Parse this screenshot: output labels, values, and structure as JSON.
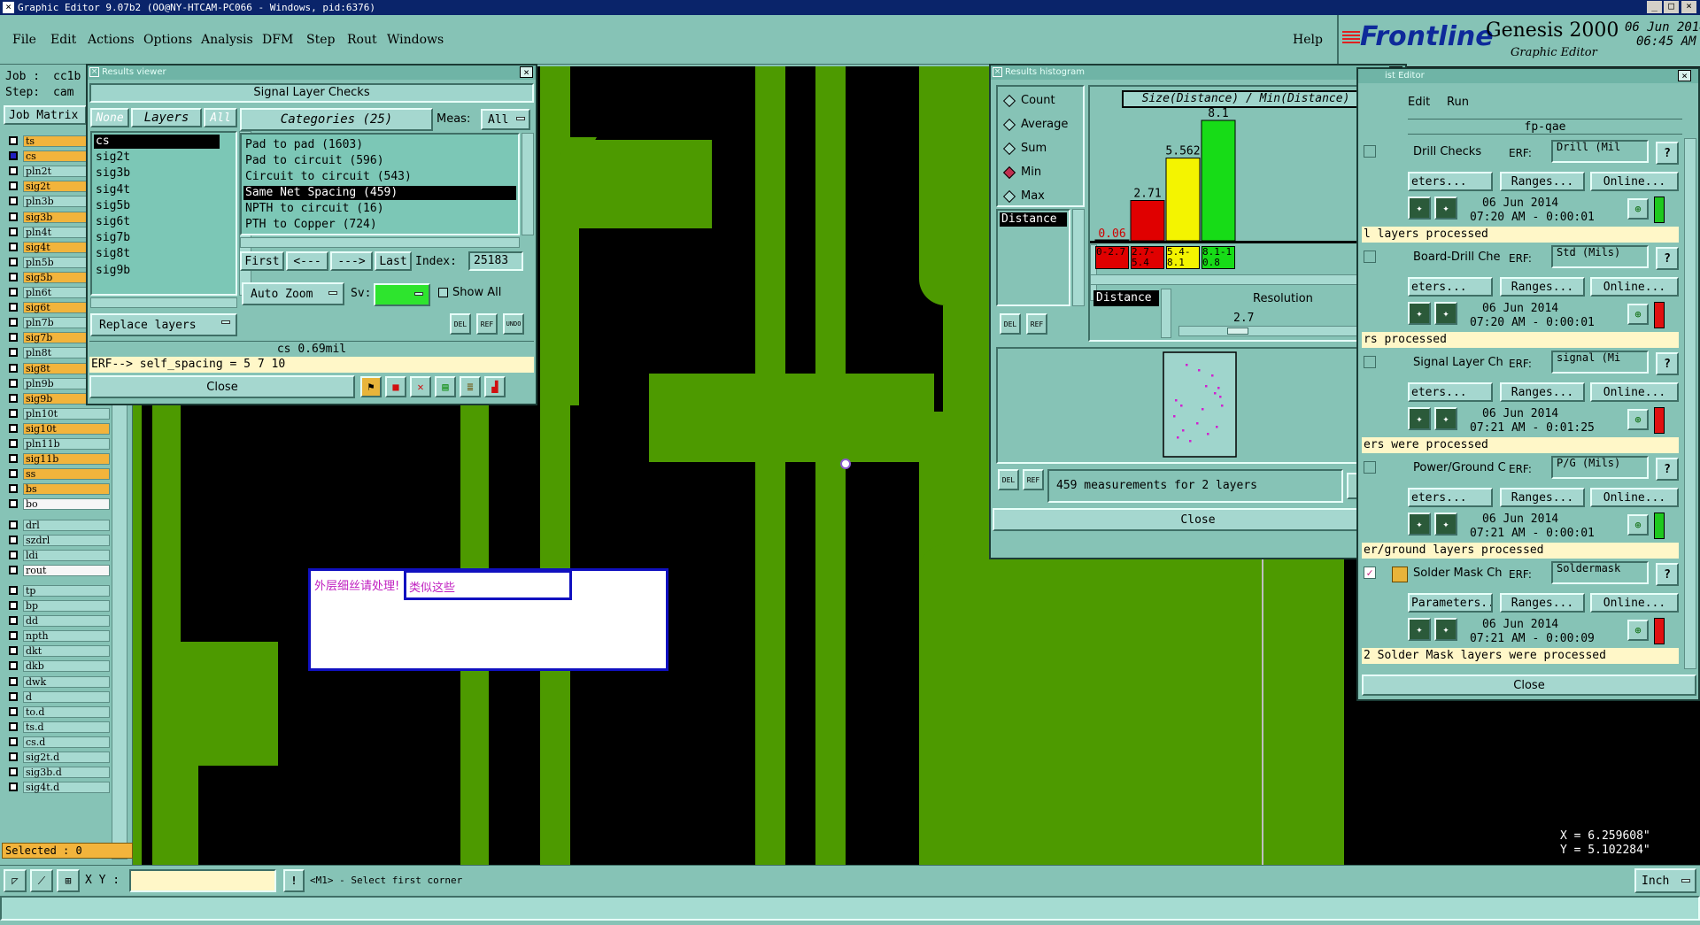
{
  "title_bar": {
    "text": "Graphic Editor 9.07b2 (OO@NY-HTCAM-PC066 - Windows, pid:6376)",
    "icon": "x-icon",
    "btn_min": "_",
    "btn_max": "□",
    "btn_close": "×"
  },
  "menu": {
    "items": [
      "File",
      "Edit",
      "Actions",
      "Options",
      "Analysis",
      "DFM",
      "Step",
      "Rout",
      "Windows"
    ],
    "help": "Help"
  },
  "brand": {
    "logo": "Frontline",
    "product": "Genesis 2000",
    "sub": "Graphic Editor",
    "date": "06 Jun 2014",
    "time": "06:45 AM"
  },
  "job": {
    "job_label": "Job :",
    "job_value": "cc1b",
    "step_label": "Step:",
    "step_value": "cam",
    "matrix_btn": "Job Matrix"
  },
  "layers": [
    {
      "name": "ts",
      "state": "on",
      "arrow": ""
    },
    {
      "name": "cs",
      "state": "on",
      "arrow": "",
      "sel": true
    },
    {
      "name": "pln2t",
      "state": "off",
      "arrow": ""
    },
    {
      "name": "sig2t",
      "state": "on",
      "arrow": ""
    },
    {
      "name": "pln3b",
      "state": "off",
      "arrow": ""
    },
    {
      "name": "sig3b",
      "state": "on",
      "arrow": ""
    },
    {
      "name": "pln4t",
      "state": "off",
      "arrow": ""
    },
    {
      "name": "sig4t",
      "state": "on",
      "arrow": ""
    },
    {
      "name": "pln5b",
      "state": "off",
      "arrow": ""
    },
    {
      "name": "sig5b",
      "state": "on",
      "arrow": ""
    },
    {
      "name": "pln6t",
      "state": "off",
      "arrow": ""
    },
    {
      "name": "sig6t",
      "state": "on",
      "arrow": ""
    },
    {
      "name": "pln7b",
      "state": "off",
      "arrow": ""
    },
    {
      "name": "sig7b",
      "state": "on",
      "arrow": ""
    },
    {
      "name": "pln8t",
      "state": "off",
      "arrow": ""
    },
    {
      "name": "sig8t",
      "state": "on",
      "arrow": "◢"
    },
    {
      "name": "pln9b",
      "state": "off",
      "arrow": ""
    },
    {
      "name": "sig9b",
      "state": "on",
      "arrow": "◢"
    },
    {
      "name": "pln10t",
      "state": "off",
      "arrow": ""
    },
    {
      "name": "sig10t",
      "state": "on",
      "arrow": "◢"
    },
    {
      "name": "pln11b",
      "state": "off",
      "arrow": ""
    },
    {
      "name": "sig11b",
      "state": "on",
      "arrow": "◢"
    },
    {
      "name": "ss",
      "state": "on",
      "arrow": "◢"
    },
    {
      "name": "bs",
      "state": "on",
      "arrow": ""
    },
    {
      "name": "bo",
      "state": "wh",
      "arrow": "◢"
    },
    {
      "name": "drl",
      "state": "off",
      "arrow": ""
    },
    {
      "name": "szdrl",
      "state": "off",
      "arrow": ""
    },
    {
      "name": "ldi",
      "state": "off",
      "arrow": ""
    },
    {
      "name": "rout",
      "state": "wh",
      "arrow": ""
    },
    {
      "name": "tp",
      "state": "off",
      "arrow": ""
    },
    {
      "name": "bp",
      "state": "off",
      "arrow": ""
    },
    {
      "name": "dd",
      "state": "off",
      "arrow": ""
    },
    {
      "name": "npth",
      "state": "off",
      "arrow": ""
    },
    {
      "name": "dkt",
      "state": "off",
      "arrow": ""
    },
    {
      "name": "dkb",
      "state": "off",
      "arrow": ""
    },
    {
      "name": "dwk",
      "state": "off",
      "arrow": ""
    },
    {
      "name": "d",
      "state": "off",
      "arrow": ""
    },
    {
      "name": "to.d",
      "state": "off",
      "arrow": "◢"
    },
    {
      "name": "ts.d",
      "state": "off",
      "arrow": ""
    },
    {
      "name": "cs.d",
      "state": "off",
      "arrow": "◢"
    },
    {
      "name": "sig2t.d",
      "state": "off",
      "arrow": "◢"
    },
    {
      "name": "sig3b.d",
      "state": "off",
      "arrow": ""
    },
    {
      "name": "sig4t.d",
      "state": "off",
      "arrow": "◢"
    }
  ],
  "selected": "Selected : 0",
  "results_viewer": {
    "title": "Results viewer",
    "header": "Signal Layer Checks",
    "none": "None",
    "layers": "Layers",
    "all": "All",
    "layer_list": [
      "cs",
      "sig2t",
      "sig3b",
      "sig4t",
      "sig5b",
      "sig6t",
      "sig7b",
      "sig8t",
      "sig9b"
    ],
    "categories_label": "Categories (25)",
    "meas_label": "Meas:",
    "meas_value": "All",
    "categories": [
      "Pad to pad (1603)",
      "Pad to circuit (596)",
      "Circuit to circuit (543)",
      "Same Net Spacing (459)",
      "NPTH to circuit (16)",
      "PTH to Copper (724)"
    ],
    "first": "First",
    "prev": "<---",
    "next": "--->",
    "last": "Last",
    "index_label": "Index:",
    "index_value": "25183",
    "auto_zoom": "Auto Zoom",
    "sv_label": "Sv:",
    "show_all": "Show All",
    "replace_layers": "Replace layers",
    "del": "DEL",
    "ref": "REF",
    "undo": "UNDO",
    "status": "cs 0.69mil",
    "erf": "ERF--> self_spacing = 5 7 10",
    "close": "Close"
  },
  "histogram": {
    "title": "Results histogram",
    "heading": "Size(Distance) / Min(Distance)",
    "options": [
      "Count",
      "Average",
      "Sum",
      "Min",
      "Max"
    ],
    "selected_option": "Min",
    "distance": "Distance",
    "resolution_label": "Resolution",
    "resolution_value": "2.7",
    "summary": "459 measurements for 2 layers",
    "close": "Close",
    "del": "DEL",
    "ref": "REF"
  },
  "chart_data": {
    "type": "bar",
    "title": "Size(Distance) / Min(Distance)",
    "categories": [
      "0-2.7",
      "2.7-5.4",
      "5.4-8.1",
      "8.1-10.8"
    ],
    "values": [
      0.06,
      2.71,
      5.562,
      8.1
    ],
    "value_labels": [
      "0.06",
      "2.71",
      "5.562",
      "8.1"
    ],
    "colors": [
      "#e00000",
      "#e00000",
      "#f4f400",
      "#17dc17"
    ],
    "ylim": [
      0,
      8.1
    ]
  },
  "checklist": {
    "title": "ist Editor",
    "menu_edit": "Edit",
    "menu_run": "Run",
    "header": "fp-qae",
    "items": [
      {
        "name": "Drill Checks",
        "erf": "ERF:",
        "erf_value": "Drill (Mil",
        "params": "eters...",
        "ranges": "Ranges...",
        "online": "Online...",
        "date": "06 Jun 2014",
        "time": "07:20 AM - 0:00:01",
        "result": "l layers processed",
        "status": "#1ec81e"
      },
      {
        "name": "Board-Drill Che",
        "erf": "ERF:",
        "erf_value": "Std (Mils)",
        "params": "eters...",
        "ranges": "Ranges...",
        "online": "Online...",
        "date": "06 Jun 2014",
        "time": "07:20 AM - 0:00:01",
        "result": "rs processed",
        "status": "#e01010"
      },
      {
        "name": "Signal Layer Ch",
        "erf": "ERF:",
        "erf_value": "signal (Mi",
        "params": "eters...",
        "ranges": "Ranges...",
        "online": "Online...",
        "date": "06 Jun 2014",
        "time": "07:21 AM - 0:01:25",
        "result": "ers were processed",
        "status": "#e01010"
      },
      {
        "name": "Power/Ground C",
        "erf": "ERF:",
        "erf_value": "P/G (Mils)",
        "params": "eters...",
        "ranges": "Ranges...",
        "online": "Online...",
        "date": "06 Jun 2014",
        "time": "07:21 AM - 0:00:01",
        "result": "er/ground layers processed",
        "status": "#1ec81e"
      },
      {
        "name": "Solder Mask Ch",
        "erf": "ERF:",
        "erf_value": "Soldermask",
        "params": "Parameters...",
        "ranges": "Ranges...",
        "online": "Online...",
        "date": "06 Jun 2014",
        "time": "07:21 AM - 0:00:09",
        "result": "2 Solder Mask layers were processed",
        "status": "#e01010"
      }
    ],
    "close": "Close"
  },
  "note": {
    "left": "外层细丝请处理!",
    "right": "类似这些"
  },
  "coords": {
    "x": "X = 6.259608\"",
    "y": "Y = 5.102284\""
  },
  "bottom": {
    "xy_label": "X Y :",
    "xy_value": "",
    "prompt": "<M1> - Select first corner",
    "unit": "Inch"
  }
}
